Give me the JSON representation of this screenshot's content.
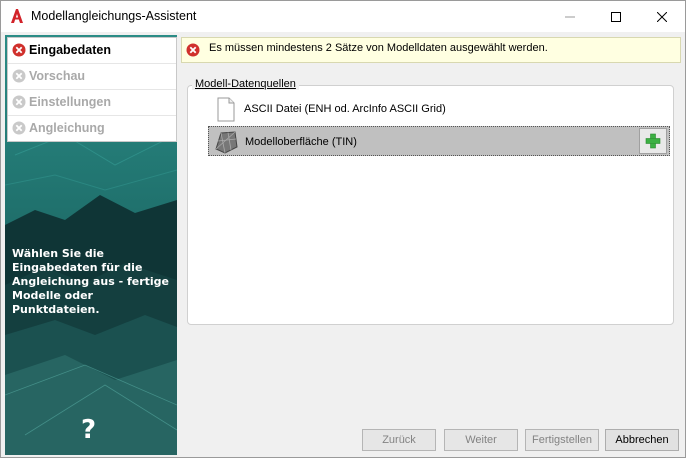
{
  "window": {
    "title": "Modellangleichungs-Assistent"
  },
  "sidebar": {
    "items": [
      {
        "label": "Eingabedaten",
        "state": "error-active"
      },
      {
        "label": "Vorschau",
        "state": "disabled"
      },
      {
        "label": "Einstellungen",
        "state": "disabled"
      },
      {
        "label": "Angleichung",
        "state": "disabled"
      }
    ],
    "description": "Wählen Sie die\nEingabedaten für die\nAngleichung aus - fertige\nModelle oder Punktdateien.",
    "help_label": "?"
  },
  "error": {
    "message": "Es müssen mindestens 2 Sätze von Modelldaten ausgewählt werden."
  },
  "sources": {
    "group_label": "Modell-Datenquellen",
    "items": [
      {
        "label": "ASCII Datei (ENH od. ArcInfo ASCII Grid)",
        "icon": "document-icon"
      },
      {
        "label": "Modelloberfläche (TIN)",
        "icon": "tin-surface-icon",
        "selected": true
      }
    ]
  },
  "buttons": {
    "back": "Zurück",
    "next": "Weiter",
    "finish": "Fertigstellen",
    "cancel": "Abbrechen"
  },
  "colors": {
    "error_red": "#d0302c",
    "accent_teal": "#1e6e6a",
    "add_green": "#3cb043"
  }
}
